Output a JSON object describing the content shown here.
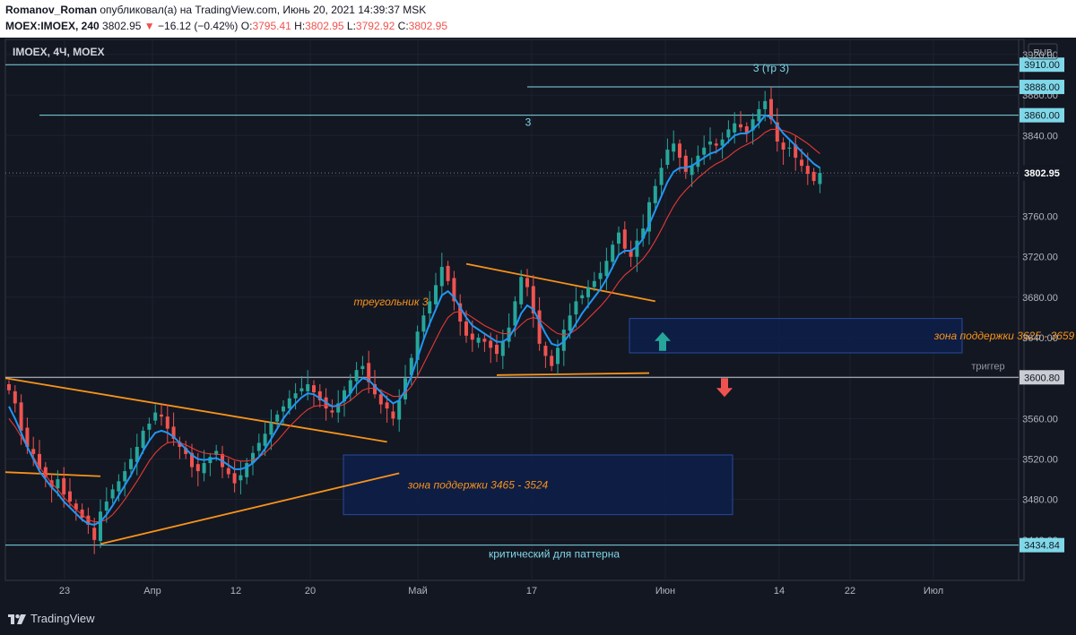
{
  "header": {
    "author": "Romanov_Roman",
    "published": "опубликовал(а) на TradingView.com, Июнь 20, 2021 14:39:37 MSK",
    "symbol": "MOEX:IMOEX, 240",
    "last": "3802.95",
    "arrow": "▼",
    "change": "−16.12 (−0.42%)",
    "o_label": "O:",
    "o_value": "3795.41",
    "h_label": "H:",
    "h_value": "3802.95",
    "l_label": "L:",
    "l_value": "3792.92",
    "c_label": "C:",
    "c_value": "3802.95"
  },
  "pane_title": "IMOEX, 4Ч, MOEX",
  "currency": "RUB",
  "footer": {
    "brand": "TradingView"
  },
  "colors": {
    "background": "#131722",
    "up": "#26a69a",
    "down": "#ef5350",
    "ma_fast": "#2196f3",
    "ma_slow": "#e53935",
    "trend": "#f7931a",
    "level": "#7fd8e8",
    "zone_fill": "#0d1f4a",
    "zone_border": "#2a4a9e"
  },
  "chart_data": {
    "type": "candlestick",
    "symbol": "MOEX:IMOEX",
    "interval": "240",
    "ylim": [
      3400,
      3935
    ],
    "y_ticks": [
      3440,
      3480,
      3520,
      3560,
      3600,
      3640,
      3680,
      3720,
      3760,
      3800,
      3840,
      3880,
      3920
    ],
    "x_ticks": [
      "23",
      "Апр",
      "12",
      "20",
      "Май",
      "17",
      "Июн",
      "14",
      "22",
      "Июл"
    ],
    "last_price": 3802.95,
    "price_tags": [
      {
        "label": "3910.00",
        "value": 3910
      },
      {
        "label": "3888.00",
        "value": 3888
      },
      {
        "label": "3860.00",
        "value": 3860
      },
      {
        "label": "3802.95",
        "value": 3802.95
      },
      {
        "label": "3600.80",
        "value": 3600.8
      },
      {
        "label": "3434.84",
        "value": 3434.84
      }
    ],
    "horizontal_levels": [
      {
        "value": 3910,
        "from": "start",
        "label": ""
      },
      {
        "value": 3888,
        "from": "14-Мая",
        "label": "3 (тр 3)"
      },
      {
        "value": 3860,
        "from": "23-Мар",
        "label": "3"
      },
      {
        "value": 3600.8,
        "from": "start",
        "label": "триггер"
      },
      {
        "value": 3434.84,
        "from": "start",
        "label": "критический для паттерна"
      }
    ],
    "support_zones": [
      {
        "label": "зона поддержки 3625 - 3659",
        "low": 3625,
        "high": 3659
      },
      {
        "label": "зона поддержки 3465 - 3524",
        "low": 3465,
        "high": 3524
      }
    ],
    "trend_label": "треугольник 3",
    "trend_lines": [
      {
        "x1": 0,
        "y1": 3600,
        "x2": 62,
        "y2": 3537
      },
      {
        "x1": 15,
        "y1": 3436,
        "x2": 64,
        "y2": 3506
      },
      {
        "x1": 0,
        "y1": 3507,
        "x2": 15,
        "y2": 3503
      },
      {
        "x1": 75,
        "y1": 3713,
        "x2": 106,
        "y2": 3676
      },
      {
        "x1": 80,
        "y1": 3603,
        "x2": 105,
        "y2": 3605
      }
    ],
    "signals": [
      {
        "type": "up-arrow",
        "value": 3635
      },
      {
        "type": "down-arrow",
        "value": 3592
      }
    ],
    "series": [
      {
        "name": "close",
        "values": [
          3588,
          3575,
          3548,
          3532,
          3525,
          3510,
          3502,
          3492,
          3500,
          3485,
          3478,
          3470,
          3462,
          3455,
          3440,
          3468,
          3478,
          3490,
          3498,
          3508,
          3520,
          3532,
          3548,
          3555,
          3566,
          3562,
          3550,
          3540,
          3532,
          3525,
          3512,
          3508,
          3516,
          3522,
          3528,
          3512,
          3505,
          3496,
          3504,
          3516,
          3526,
          3536,
          3545,
          3556,
          3564,
          3572,
          3580,
          3585,
          3590,
          3594,
          3586,
          3578,
          3570,
          3566,
          3575,
          3588,
          3598,
          3608,
          3612,
          3596,
          3584,
          3574,
          3570,
          3560,
          3578,
          3600,
          3620,
          3646,
          3662,
          3676,
          3692,
          3710,
          3696,
          3676,
          3656,
          3642,
          3638,
          3640,
          3636,
          3630,
          3624,
          3636,
          3650,
          3676,
          3700,
          3690,
          3664,
          3634,
          3622,
          3612,
          3630,
          3648,
          3662,
          3676,
          3682,
          3690,
          3696,
          3704,
          3716,
          3732,
          3744,
          3728,
          3720,
          3736,
          3748,
          3774,
          3790,
          3808,
          3826,
          3832,
          3818,
          3804,
          3810,
          3820,
          3828,
          3834,
          3830,
          3836,
          3846,
          3852,
          3848,
          3842,
          3856,
          3866,
          3874,
          3856,
          3834,
          3826,
          3828,
          3818,
          3810,
          3802,
          3795,
          3802.95
        ]
      },
      {
        "name": "ma_fast",
        "values": [
          3572,
          3560,
          3546,
          3532,
          3520,
          3508,
          3500,
          3492,
          3486,
          3478,
          3472,
          3466,
          3460,
          3456,
          3455,
          3458,
          3465,
          3474,
          3484,
          3494,
          3504,
          3516,
          3528,
          3538,
          3546,
          3548,
          3546,
          3542,
          3536,
          3530,
          3524,
          3520,
          3519,
          3520,
          3521,
          3518,
          3514,
          3510,
          3510,
          3512,
          3516,
          3522,
          3530,
          3540,
          3550,
          3560,
          3568,
          3575,
          3581,
          3585,
          3584,
          3580,
          3576,
          3572,
          3573,
          3578,
          3585,
          3594,
          3600,
          3598,
          3592,
          3586,
          3580,
          3575,
          3578,
          3588,
          3602,
          3620,
          3638,
          3654,
          3668,
          3682,
          3686,
          3680,
          3670,
          3660,
          3652,
          3648,
          3644,
          3640,
          3636,
          3636,
          3640,
          3650,
          3664,
          3672,
          3668,
          3656,
          3644,
          3634,
          3632,
          3636,
          3644,
          3654,
          3664,
          3672,
          3680,
          3688,
          3698,
          3710,
          3722,
          3726,
          3726,
          3730,
          3738,
          3752,
          3766,
          3780,
          3794,
          3804,
          3808,
          3808,
          3810,
          3814,
          3818,
          3822,
          3824,
          3828,
          3834,
          3840,
          3842,
          3842,
          3846,
          3852,
          3860,
          3858,
          3850,
          3842,
          3836,
          3830,
          3824,
          3818,
          3812,
          3808
        ]
      },
      {
        "name": "ma_slow",
        "values": [
          3560,
          3552,
          3542,
          3532,
          3522,
          3512,
          3504,
          3496,
          3490,
          3482,
          3476,
          3470,
          3465,
          3460,
          3458,
          3458,
          3460,
          3465,
          3472,
          3480,
          3489,
          3498,
          3508,
          3518,
          3526,
          3532,
          3536,
          3537,
          3536,
          3534,
          3531,
          3528,
          3526,
          3525,
          3525,
          3524,
          3522,
          3519,
          3518,
          3518,
          3519,
          3522,
          3526,
          3532,
          3538,
          3545,
          3552,
          3558,
          3564,
          3569,
          3572,
          3573,
          3573,
          3572,
          3572,
          3574,
          3578,
          3583,
          3588,
          3590,
          3590,
          3588,
          3585,
          3582,
          3582,
          3585,
          3592,
          3602,
          3614,
          3626,
          3638,
          3650,
          3660,
          3665,
          3666,
          3664,
          3660,
          3656,
          3652,
          3649,
          3646,
          3644,
          3644,
          3647,
          3653,
          3658,
          3660,
          3658,
          3653,
          3648,
          3644,
          3643,
          3644,
          3648,
          3653,
          3659,
          3665,
          3671,
          3678,
          3686,
          3695,
          3702,
          3707,
          3712,
          3718,
          3726,
          3736,
          3747,
          3759,
          3770,
          3779,
          3786,
          3792,
          3798,
          3803,
          3808,
          3812,
          3815,
          3819,
          3824,
          3828,
          3831,
          3834,
          3838,
          3843,
          3846,
          3846,
          3845,
          3843,
          3840,
          3836,
          3832,
          3827,
          3822
        ]
      }
    ]
  }
}
